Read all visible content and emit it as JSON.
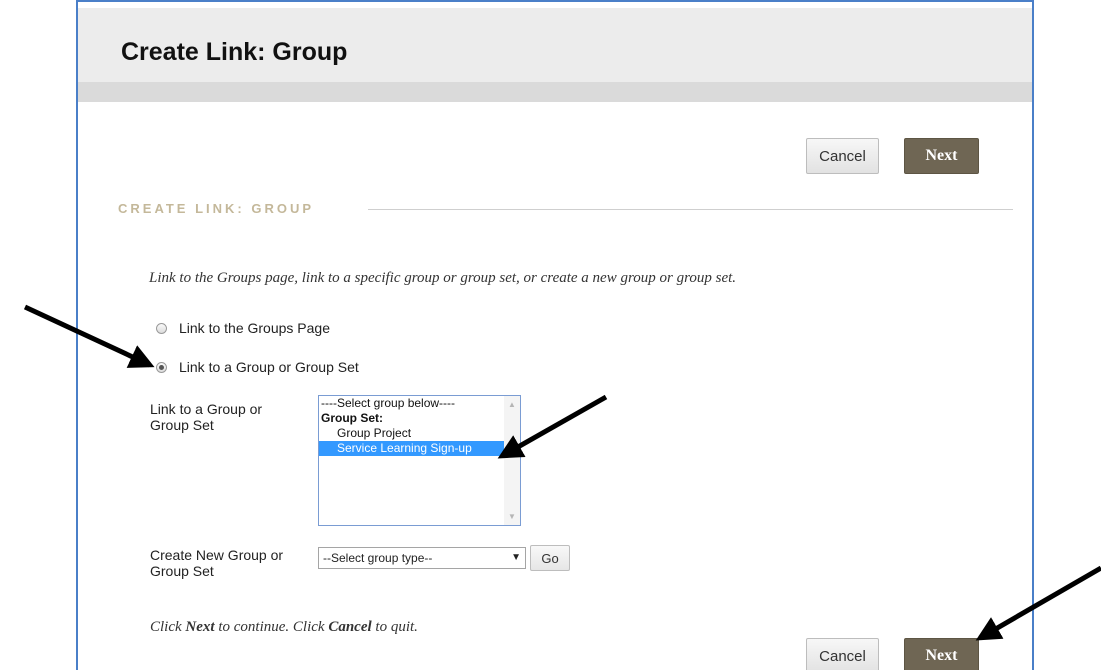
{
  "page": {
    "title": "Create Link: Group"
  },
  "top_buttons": {
    "cancel": "Cancel",
    "next": "Next"
  },
  "section": {
    "heading": "CREATE LINK: GROUP",
    "instructions": "Link to the Groups page, link to a specific group or group set, or create a new group or group set."
  },
  "options": {
    "groups_page": {
      "label": "Link to the Groups Page",
      "checked": false
    },
    "group_or_set": {
      "label": "Link to a Group or Group Set",
      "checked": true
    }
  },
  "group_select": {
    "label": "Link to a Group or Group Set",
    "items": [
      {
        "text": "----Select group below----",
        "type": "placeholder"
      },
      {
        "text": "Group Set:",
        "type": "group-header"
      },
      {
        "text": "Group Project",
        "type": "item"
      },
      {
        "text": "Service Learning Sign-up",
        "type": "item",
        "selected": true
      }
    ]
  },
  "create_new": {
    "label": "Create New Group or Group Set",
    "select_value": "--Select group type--",
    "go_label": "Go"
  },
  "footer": {
    "note_part1": "Click ",
    "note_next": "Next",
    "note_part2": " to continue. Click ",
    "note_cancel": "Cancel",
    "note_part3": " to quit."
  },
  "bottom_buttons": {
    "cancel": "Cancel",
    "next": "Next"
  },
  "colors": {
    "frame_border": "#4a7fc8",
    "next_button": "#6f6654",
    "section_heading": "#c4b89a",
    "selection": "#3399ff"
  }
}
